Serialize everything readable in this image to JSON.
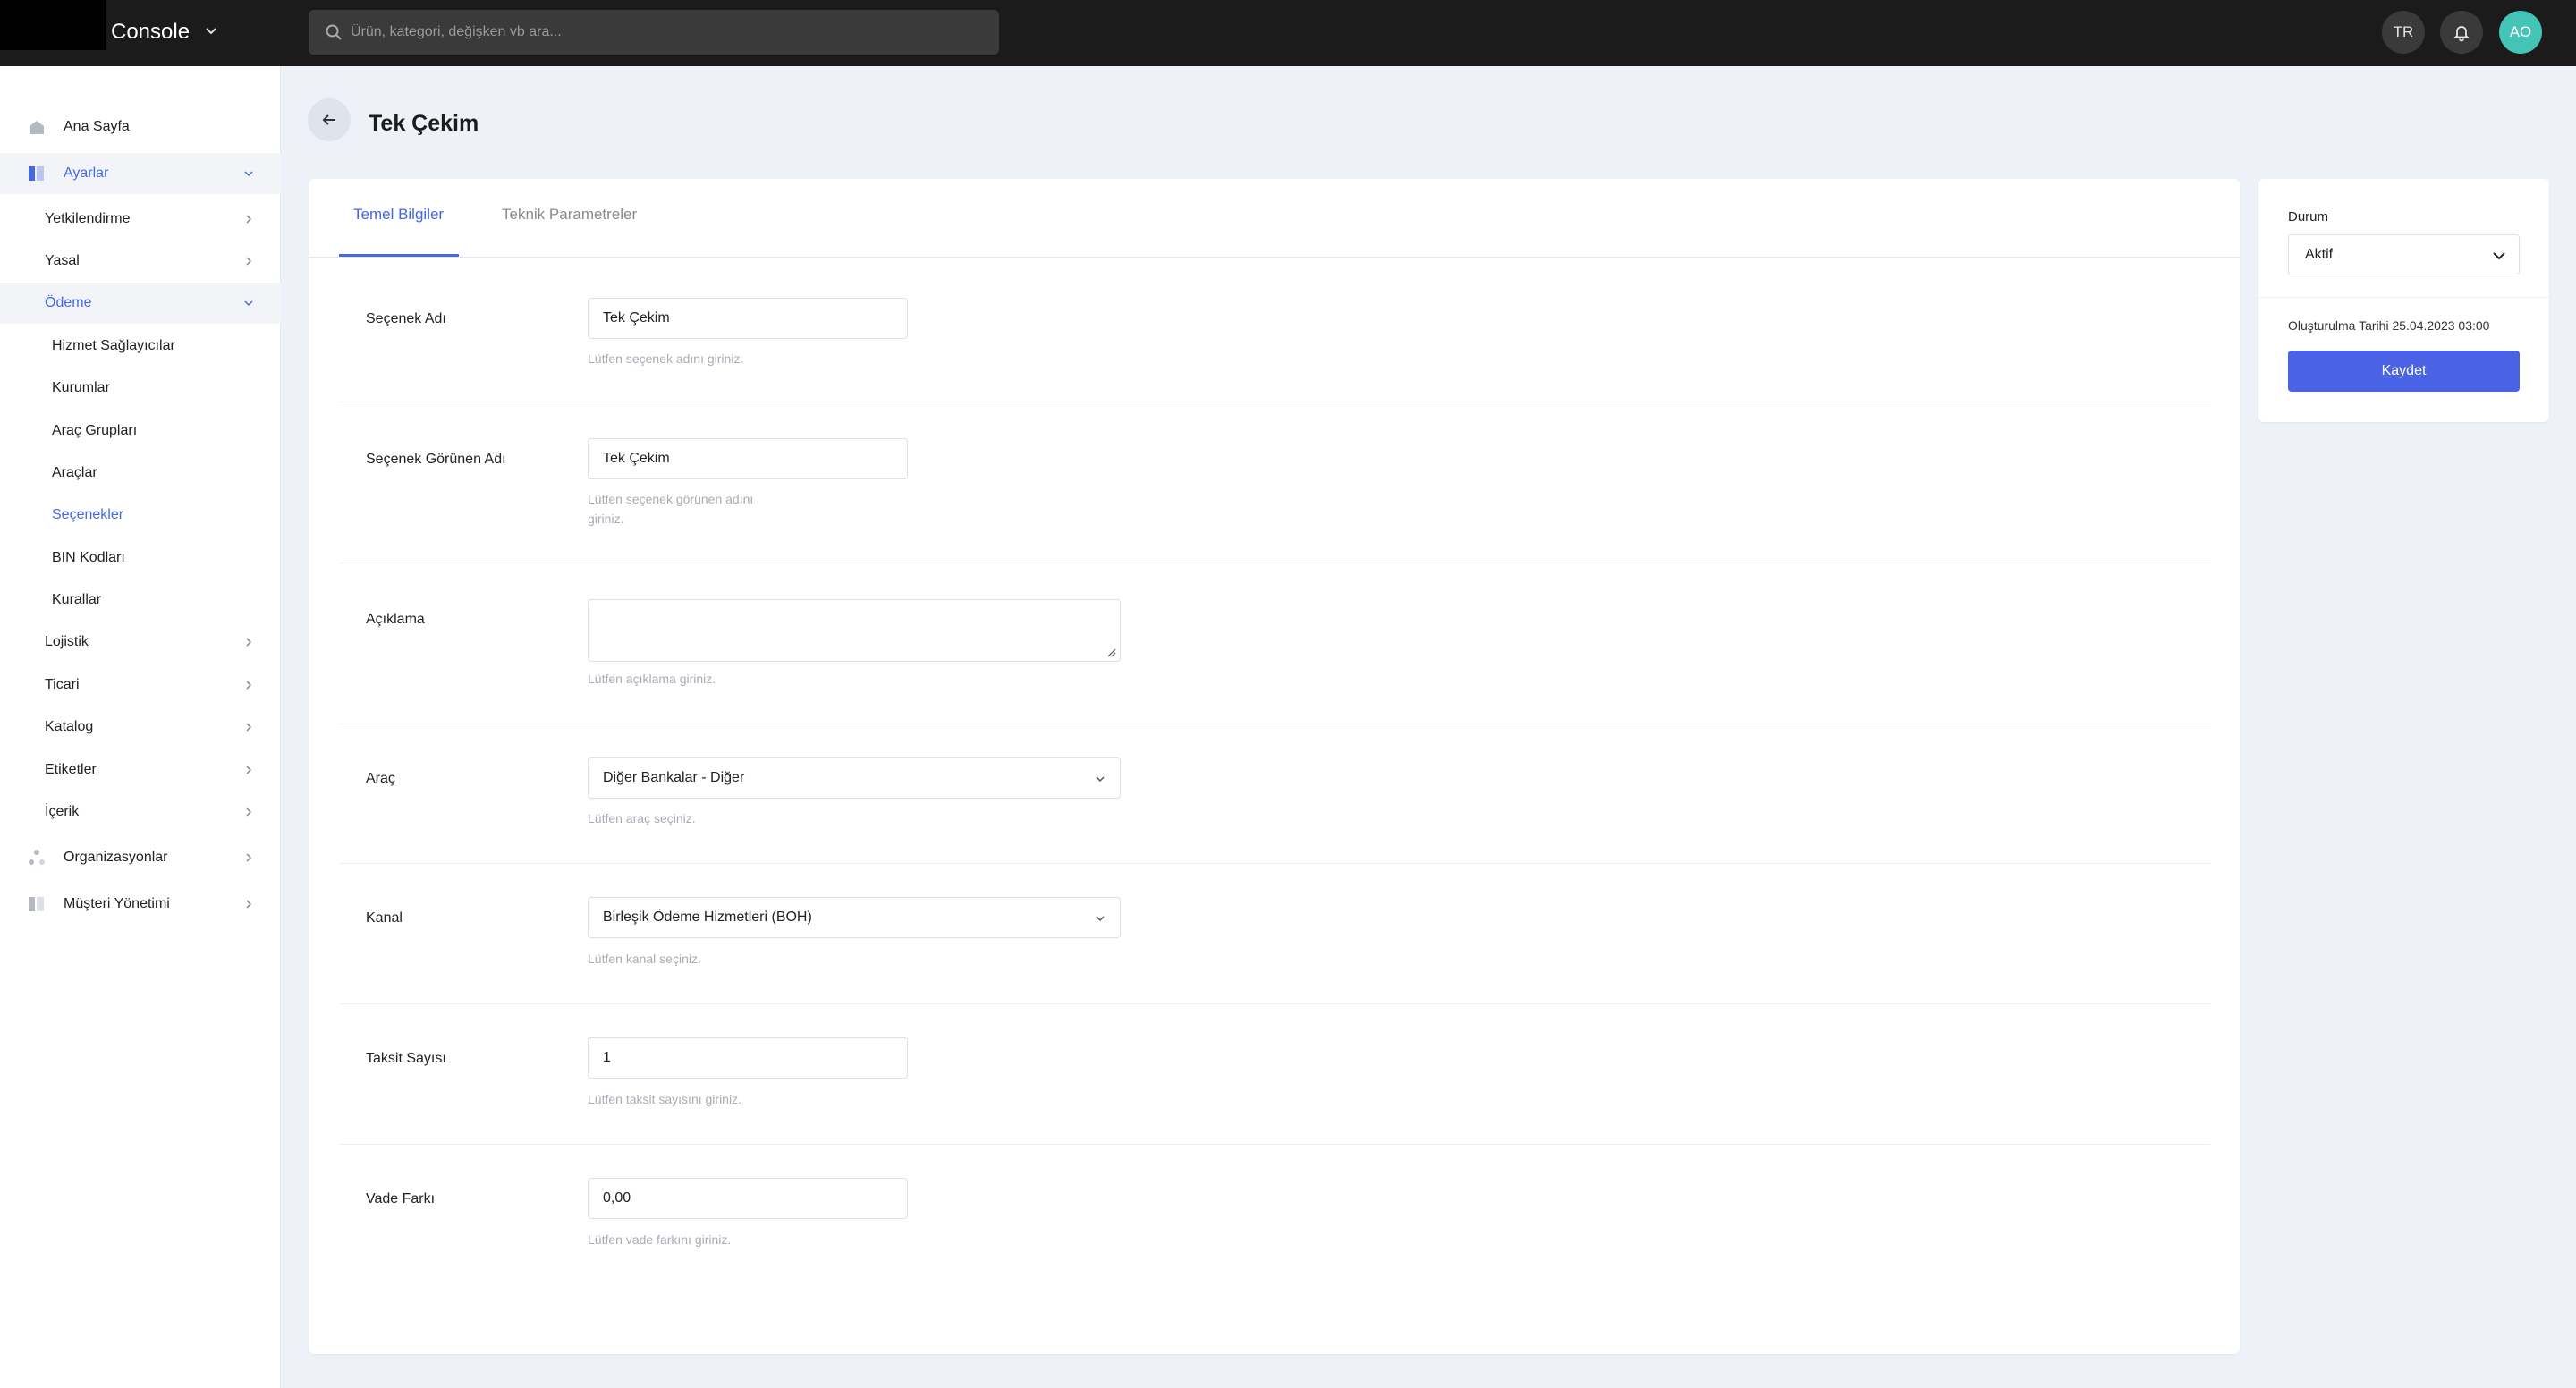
{
  "topbar": {
    "brand": "Console",
    "search_placeholder": "Ürün, kategori, değişken vb ara...",
    "language": "TR",
    "avatar_initials": "AO"
  },
  "sidebar": {
    "items": [
      {
        "label": "Ana Sayfa"
      },
      {
        "label": "Ayarlar"
      },
      {
        "label": "Yetkilendirme"
      },
      {
        "label": "Yasal"
      },
      {
        "label": "Ödeme"
      },
      {
        "label": "Hizmet Sağlayıcılar"
      },
      {
        "label": "Kurumlar"
      },
      {
        "label": "Araç Grupları"
      },
      {
        "label": "Araçlar"
      },
      {
        "label": "Seçenekler"
      },
      {
        "label": "BIN Kodları"
      },
      {
        "label": "Kurallar"
      },
      {
        "label": "Lojistik"
      },
      {
        "label": "Ticari"
      },
      {
        "label": "Katalog"
      },
      {
        "label": "Etiketler"
      },
      {
        "label": "İçerik"
      },
      {
        "label": "Organizasyonlar"
      },
      {
        "label": "Müşteri Yönetimi"
      }
    ]
  },
  "page": {
    "title": "Tek Çekim"
  },
  "tabs": [
    {
      "label": "Temel Bilgiler"
    },
    {
      "label": "Teknik Parametreler"
    }
  ],
  "form": {
    "option_name": {
      "label": "Seçenek Adı",
      "value": "Tek Çekim",
      "hint": "Lütfen seçenek adını giriniz."
    },
    "display_name": {
      "label": "Seçenek Görünen Adı",
      "value": "Tek Çekim",
      "hint_line1": "Lütfen seçenek görünen adını",
      "hint_line2": "giriniz."
    },
    "description": {
      "label": "Açıklama",
      "value": "",
      "hint": "Lütfen açıklama giriniz."
    },
    "tool": {
      "label": "Araç",
      "value": "Diğer Bankalar - Diğer",
      "hint": "Lütfen araç seçiniz."
    },
    "channel": {
      "label": "Kanal",
      "value": "Birleşik Ödeme Hizmetleri (BOH)",
      "hint": "Lütfen kanal seçiniz."
    },
    "installments": {
      "label": "Taksit Sayısı",
      "value": "1",
      "hint": "Lütfen taksit sayısını giriniz."
    },
    "maturity_diff": {
      "label": "Vade Farkı",
      "value": "0,00",
      "hint": "Lütfen vade farkını giriniz."
    }
  },
  "side": {
    "status_label": "Durum",
    "status_value": "Aktif",
    "created": "Oluşturulma Tarihi 25.04.2023 03:00",
    "save_label": "Kaydet"
  },
  "colors": {
    "accent": "#4468e8",
    "primary_button": "#4a63e6",
    "topbar": "#1b1b1b",
    "avatar": "#44c4b6"
  }
}
